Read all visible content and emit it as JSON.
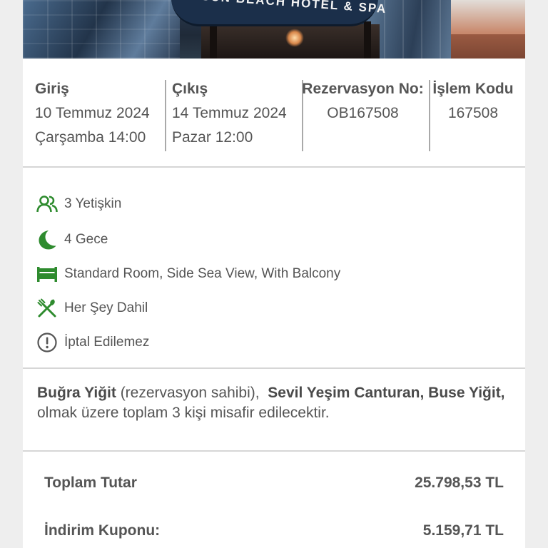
{
  "hotel": {
    "sign_text": "SUN BEACH HOTEL & SPA"
  },
  "dates": {
    "checkin": {
      "label": "Giriş",
      "date": "10 Temmuz 2024",
      "day_time": "Çarşamba 14:00"
    },
    "checkout": {
      "label": "Çıkış",
      "date": "14 Temmuz 2024",
      "day_time": "Pazar 12:00"
    },
    "reservation": {
      "label": "Rezervasyon No:",
      "value": "OB167508"
    },
    "transaction": {
      "label": "İşlem Kodu",
      "value": "167508"
    }
  },
  "features": [
    {
      "icon": "users-icon",
      "label": "3 Yetişkin"
    },
    {
      "icon": "moon-icon",
      "label": "4 Gece"
    },
    {
      "icon": "bed-icon",
      "label": "Standard Room, Side Sea View, With Balcony"
    },
    {
      "icon": "fork-knife-icon",
      "label": "Her Şey Dahil"
    },
    {
      "icon": "info-circle-icon",
      "label": "İptal Edilemez"
    }
  ],
  "guests": {
    "owner": "Buğra Yiğit",
    "owner_note": " (rezervasyon sahibi), ",
    "others": "Sevil Yeşim Canturan, Buse Yiğit,",
    "suffix": " olmak üzere toplam 3 kişi misafir edilecektir."
  },
  "totals": {
    "total_label": "Toplam Tutar",
    "total_value": "25.798,53 TL",
    "discount_label": "İndirim Kuponu:",
    "discount_value": "5.159,71 TL"
  },
  "colors": {
    "icon_green": "#2e8b2e",
    "text": "#555555"
  }
}
